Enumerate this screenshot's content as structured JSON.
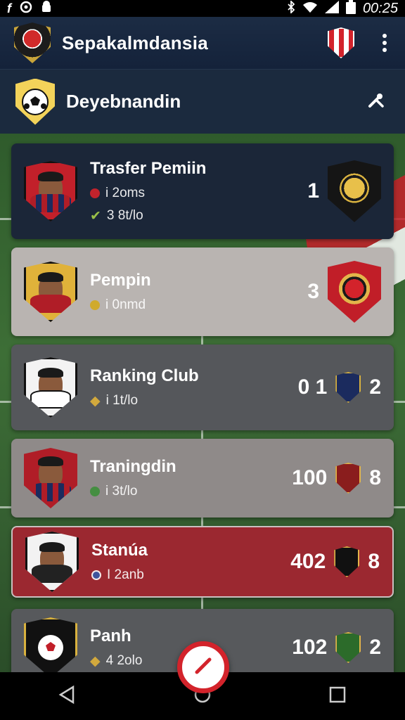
{
  "status_bar": {
    "time": "00:25",
    "icons": [
      "facebook-icon",
      "alarm-icon",
      "android-icon",
      "bluetooth-icon",
      "wifi-icon",
      "signal-icon",
      "battery-icon"
    ]
  },
  "app_bar": {
    "title": "Sepakalmdansia",
    "icons": [
      "app-logo-icon",
      "club-crest-icon",
      "more-vert-icon"
    ]
  },
  "sub_bar": {
    "title": "Deyebnandin",
    "icons": [
      "soccer-ball-icon",
      "tool-icon"
    ]
  },
  "cards": [
    {
      "title": "Trasfer Pemiin",
      "meta1": "i 2oms",
      "meta2": "3 8t/lo",
      "rank": "1",
      "rank2": "",
      "bg": "#1b2638"
    },
    {
      "title": "Pempin",
      "meta1": "i 0nmd",
      "meta2": "",
      "rank": "3",
      "rank2": "",
      "bg": "#b9b4b1"
    },
    {
      "title": "Ranking Club",
      "meta1": "i 1t/lo",
      "meta2": "",
      "rank": "0 1",
      "rank2": "2",
      "bg": "#55575b"
    },
    {
      "title": "Traningdin",
      "meta1": "i 3t/lo",
      "meta2": "",
      "rank": "100",
      "rank2": "8",
      "bg": "#8f8a89"
    },
    {
      "title": "Stanúa",
      "meta1": "I 2anb",
      "meta2": "",
      "rank": "402",
      "rank2": "8",
      "bg": "#9b2830"
    },
    {
      "title": "Panh",
      "meta1": "4 2olo",
      "meta2": "",
      "rank": "102",
      "rank2": "2",
      "bg": "#57595c"
    }
  ],
  "nav_bar": {
    "icons": [
      "back-icon",
      "home-icon",
      "recents-icon"
    ]
  },
  "fab": {
    "icon": "edit-icon"
  }
}
